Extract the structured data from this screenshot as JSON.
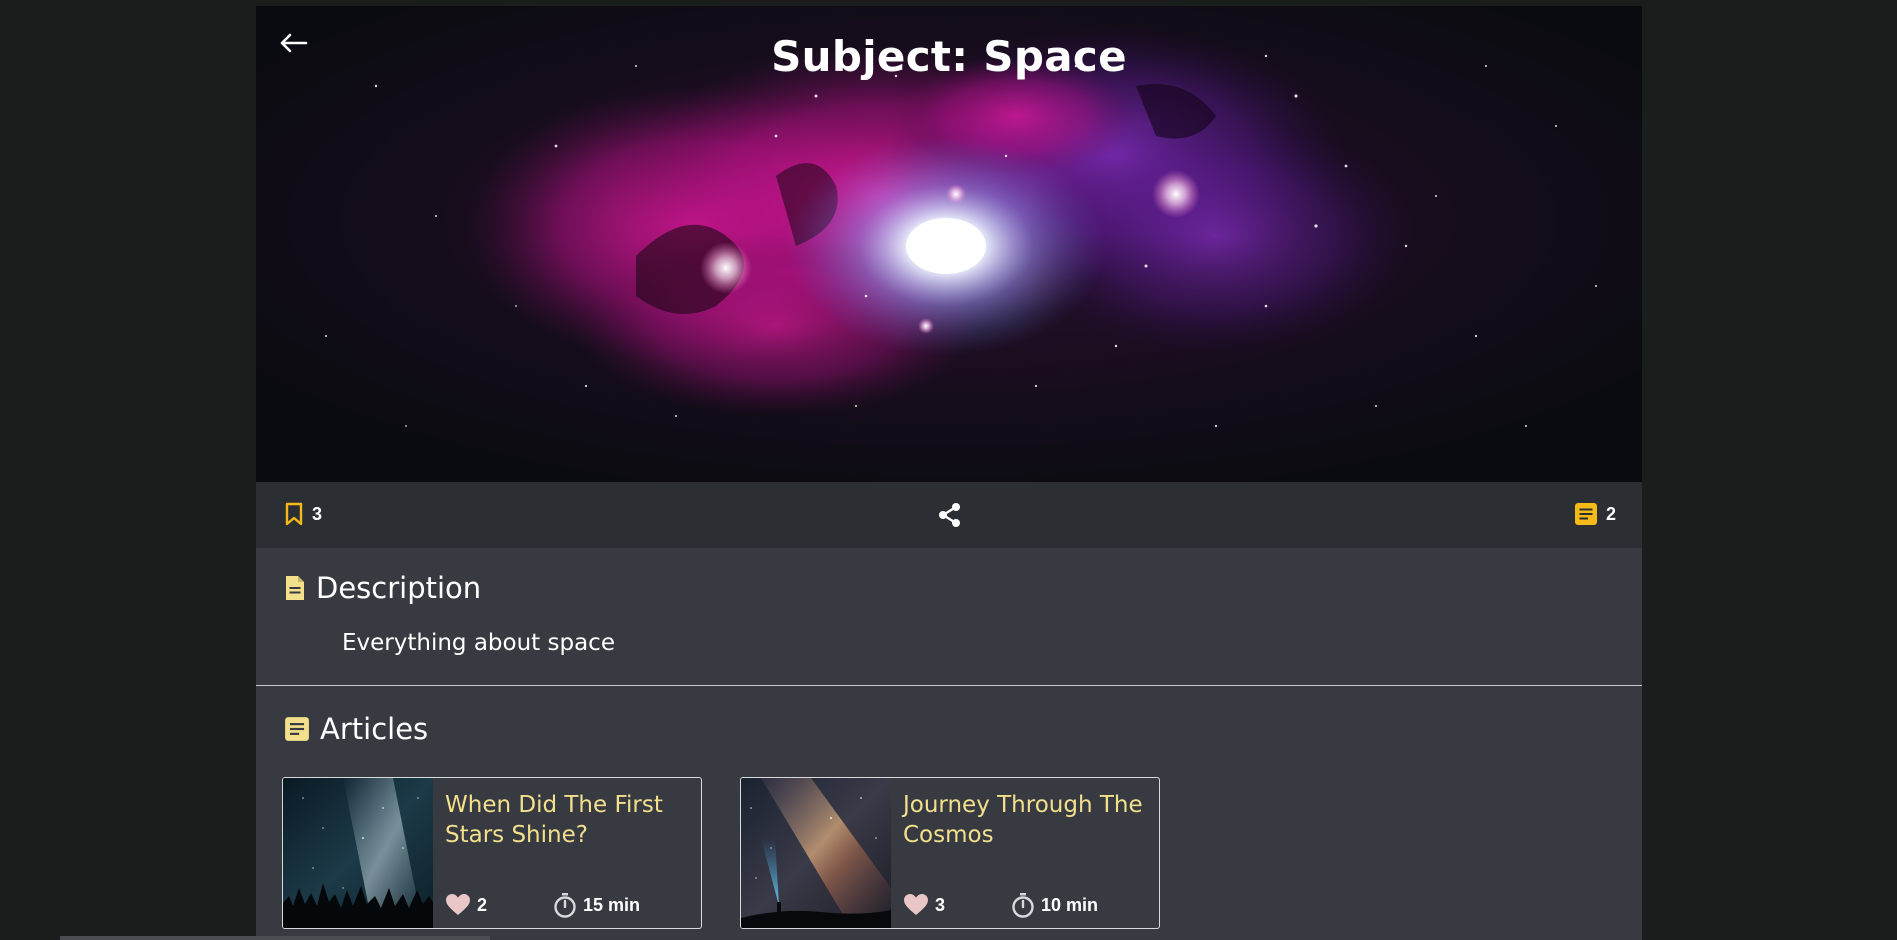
{
  "hero": {
    "title": "Subject: Space",
    "back_icon": "arrow-left-icon"
  },
  "action_bar": {
    "bookmark_icon": "bookmark-icon",
    "bookmark_count": "3",
    "share_icon": "share-icon",
    "articles_icon": "article-icon",
    "articles_count": "2",
    "accent_color": "#f6b91a"
  },
  "description": {
    "heading": "Description",
    "icon": "document-icon",
    "text": "Everything about space"
  },
  "articles": {
    "heading": "Articles",
    "icon": "article-icon",
    "items": [
      {
        "title": "When Did The First Stars Shine?",
        "likes": "2",
        "duration": "15 min",
        "like_icon": "heart-icon",
        "time_icon": "stopwatch-icon"
      },
      {
        "title": "Journey Through The Cosmos",
        "likes": "3",
        "duration": "10 min",
        "like_icon": "heart-icon",
        "time_icon": "stopwatch-icon"
      }
    ],
    "title_color": "#f2e08c"
  }
}
